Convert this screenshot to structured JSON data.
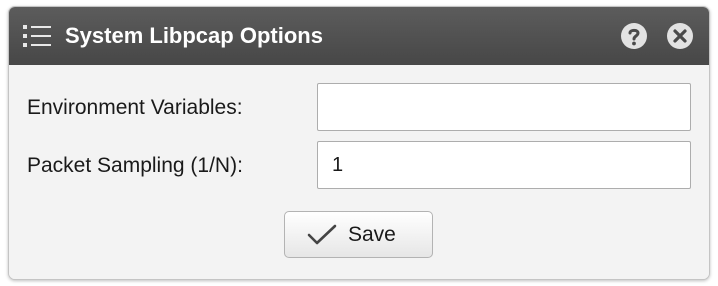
{
  "dialog": {
    "title": "System Libpcap Options",
    "icons": {
      "menu": "list-icon",
      "help": "help-icon",
      "close": "close-icon"
    }
  },
  "form": {
    "environment_variables": {
      "label": "Environment Variables:",
      "value": ""
    },
    "packet_sampling": {
      "label": "Packet Sampling (1/N):",
      "value": "1"
    }
  },
  "actions": {
    "save_label": "Save",
    "save_icon": "checkmark-icon"
  },
  "colors": {
    "titlebar": "#4f4f4f",
    "dialog_background": "#f3f3f3",
    "input_border": "#adadad"
  }
}
